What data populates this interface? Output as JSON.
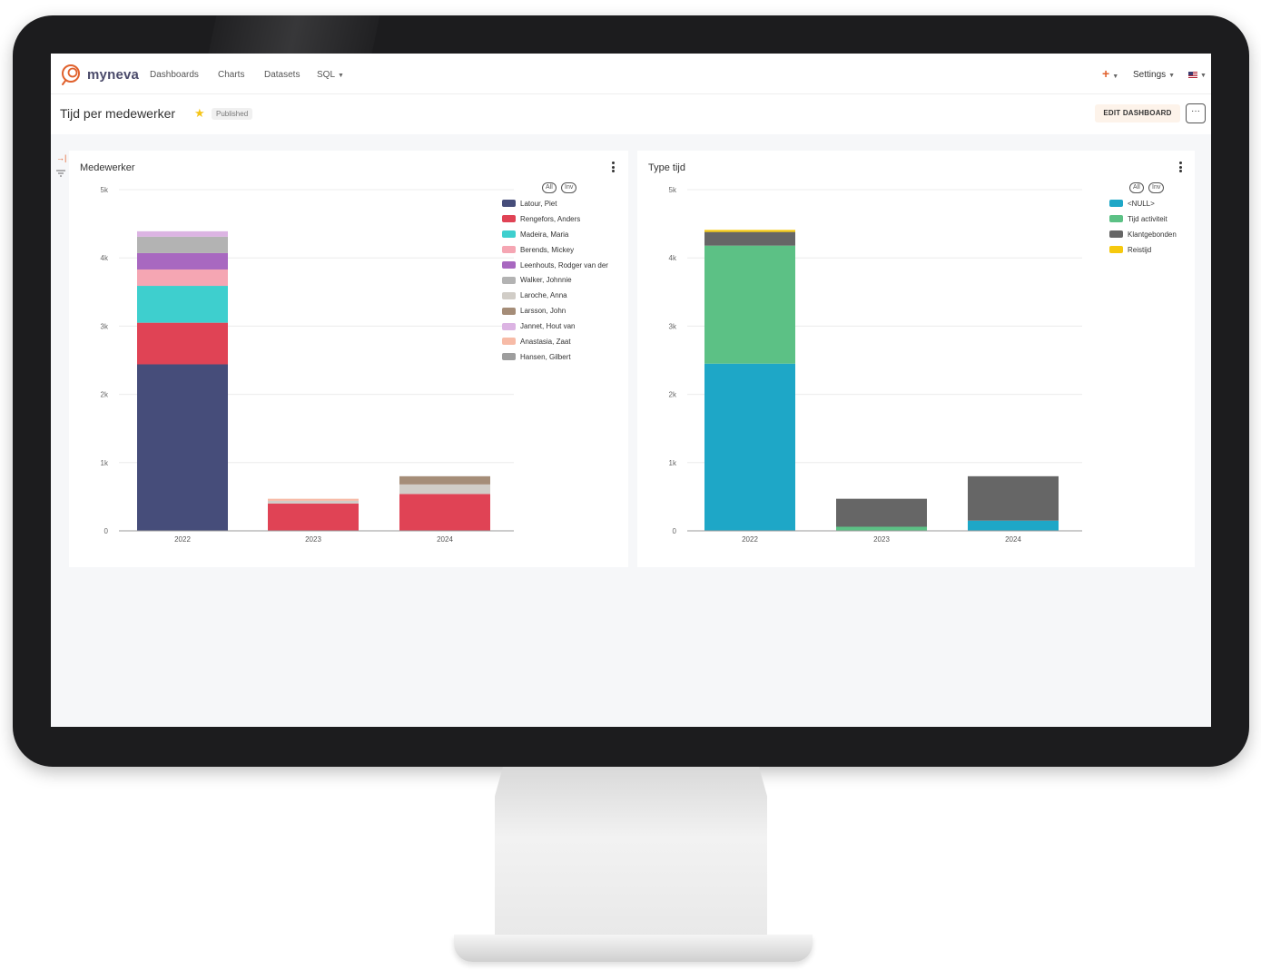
{
  "nav": {
    "brand": "myneva",
    "items": [
      "Dashboards",
      "Charts",
      "Datasets",
      "SQL"
    ],
    "settings": "Settings",
    "plus": "+"
  },
  "header": {
    "title": "Tijd per medewerker",
    "status": "Published",
    "edit_label": "EDIT DASHBOARD",
    "more": "···"
  },
  "legend_controls": {
    "all": "All",
    "inv": "Inv"
  },
  "chart_data": [
    {
      "type": "bar",
      "stacked": true,
      "title": "Medewerker",
      "categories": [
        "2022",
        "2023",
        "2024"
      ],
      "ylim": [
        0,
        5000
      ],
      "yticks": [
        "0",
        "1k",
        "2k",
        "3k",
        "4k",
        "5k"
      ],
      "legend_position": "top-right",
      "series": [
        {
          "name": "Latour, Piet",
          "color": "#464d7a",
          "values": [
            2440,
            0,
            0
          ]
        },
        {
          "name": "Rengefors, Anders",
          "color": "#e04355",
          "values": [
            610,
            400,
            540
          ]
        },
        {
          "name": "Madeira, Maria",
          "color": "#3ecfce",
          "values": [
            540,
            0,
            0
          ]
        },
        {
          "name": "Berends, Mickey",
          "color": "#f5a6b3",
          "values": [
            240,
            0,
            0
          ]
        },
        {
          "name": "Leenhouts, Rodger van der",
          "color": "#a868c0",
          "values": [
            240,
            0,
            0
          ]
        },
        {
          "name": "Walker, Johnnie",
          "color": "#b3b3b3",
          "values": [
            240,
            0,
            0
          ]
        },
        {
          "name": "Laroche, Anna",
          "color": "#d1cdc7",
          "values": [
            0,
            40,
            140
          ]
        },
        {
          "name": "Larsson, John",
          "color": "#a58d78",
          "values": [
            0,
            0,
            120
          ]
        },
        {
          "name": "Jannet, Hout van",
          "color": "#dcb4e3",
          "values": [
            80,
            0,
            0
          ]
        },
        {
          "name": "Anastasia, Zaat",
          "color": "#f7bba7",
          "values": [
            0,
            30,
            0
          ]
        },
        {
          "name": "Hansen, Gilbert",
          "color": "#9e9e9e",
          "values": [
            0,
            0,
            0
          ]
        }
      ]
    },
    {
      "type": "bar",
      "stacked": true,
      "title": "Type tijd",
      "categories": [
        "2022",
        "2023",
        "2024"
      ],
      "ylim": [
        0,
        5000
      ],
      "yticks": [
        "0",
        "1k",
        "2k",
        "3k",
        "4k",
        "5k"
      ],
      "legend_position": "top-right",
      "series": [
        {
          "name": "<NULL>",
          "color": "#1ea7c7",
          "values": [
            2450,
            0,
            150
          ]
        },
        {
          "name": "Tijd activiteit",
          "color": "#5cc185",
          "values": [
            1730,
            60,
            0
          ]
        },
        {
          "name": "Klantgebonden",
          "color": "#666666",
          "values": [
            200,
            410,
            650
          ]
        },
        {
          "name": "Reistijd",
          "color": "#f6c90e",
          "values": [
            30,
            0,
            0
          ]
        }
      ]
    }
  ]
}
